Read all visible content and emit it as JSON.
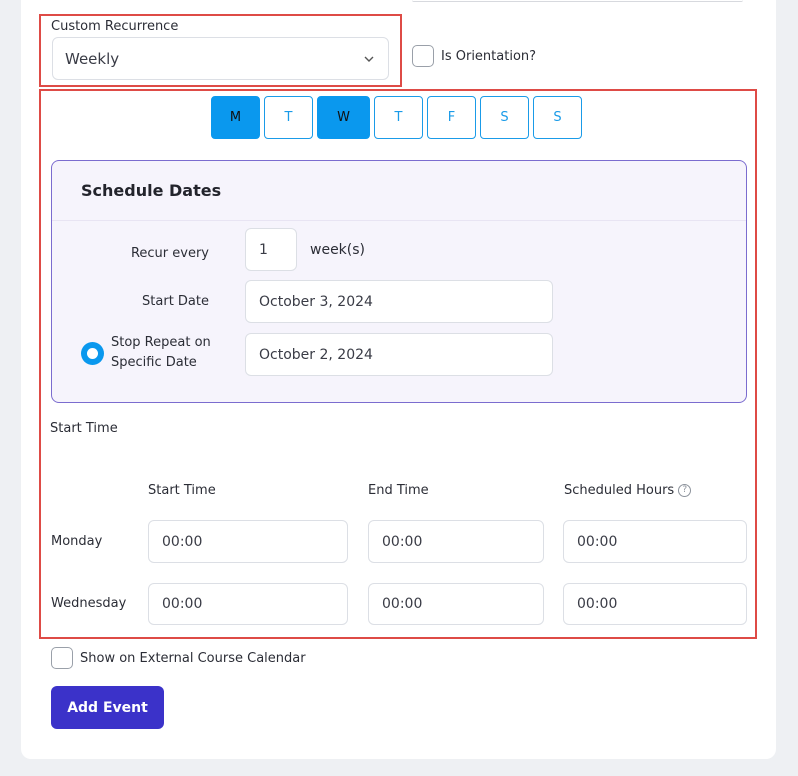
{
  "recurrence": {
    "label": "Custom Recurrence",
    "selected": "Weekly"
  },
  "orientation": {
    "label": "Is Orientation?"
  },
  "days": [
    {
      "label": "M",
      "active": true
    },
    {
      "label": "T",
      "active": false
    },
    {
      "label": "W",
      "active": true
    },
    {
      "label": "T",
      "active": false
    },
    {
      "label": "F",
      "active": false
    },
    {
      "label": "S",
      "active": false
    },
    {
      "label": "S",
      "active": false
    }
  ],
  "schedule": {
    "title": "Schedule Dates",
    "recur_every_label": "Recur every",
    "recur_every_value": "1",
    "recur_unit": "week(s)",
    "start_date_label": "Start Date",
    "start_date_value": "October 3, 2024",
    "stop_repeat_label_line1": "Stop Repeat on",
    "stop_repeat_label_line2": "Specific Date",
    "stop_date_value": "October 2, 2024"
  },
  "start_time_section": {
    "title": "Start Time",
    "col_start": "Start Time",
    "col_end": "End Time",
    "col_hours": "Scheduled Hours",
    "help_glyph": "?",
    "rows": [
      {
        "day": "Monday",
        "start": "00:00",
        "end": "00:00",
        "hours": "00:00"
      },
      {
        "day": "Wednesday",
        "start": "00:00",
        "end": "00:00",
        "hours": "00:00"
      }
    ]
  },
  "external_calendar": {
    "label": "Show on External Course Calendar"
  },
  "actions": {
    "add_event": "Add Event"
  },
  "colors": {
    "accent": "#0a98ee",
    "primary_button": "#3b32c9",
    "highlight_border": "#de4b46",
    "schedule_border": "#7b6ccf"
  }
}
